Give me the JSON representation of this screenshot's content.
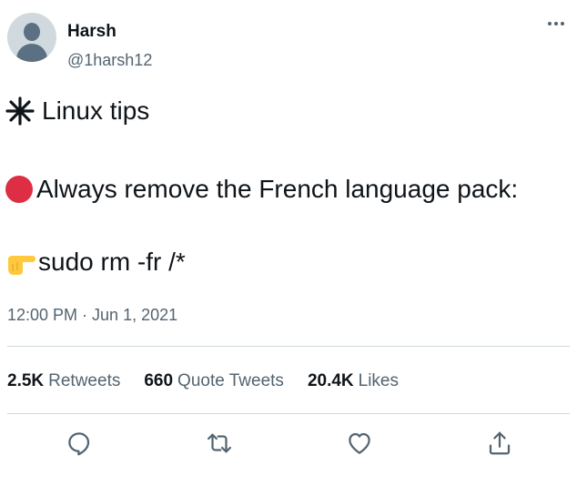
{
  "author": {
    "display_name": "Harsh",
    "handle": "@1harsh12"
  },
  "tweet": {
    "lines": [
      {
        "emoji": "sparkle-icon",
        "text": "Linux tips"
      },
      {
        "emoji": "red-circle-icon",
        "text": "Always remove the French language pack:"
      },
      {
        "emoji": "pointing-right-icon",
        "text": "sudo rm -fr /*"
      }
    ],
    "timestamp": "12:00 PM · Jun 1, 2021"
  },
  "stats": {
    "retweets": {
      "count": "2.5K",
      "label": "Retweets"
    },
    "quote_tweets": {
      "count": "660",
      "label": "Quote Tweets"
    },
    "likes": {
      "count": "20.4K",
      "label": "Likes"
    }
  },
  "actions": [
    "reply-icon",
    "retweet-icon",
    "like-icon",
    "share-icon"
  ],
  "colors": {
    "primary_text": "#0f1419",
    "secondary_text": "#536471",
    "divider": "#cfd9de",
    "red_circle": "#dd2e44",
    "hand_yellow": "#ffc83d"
  }
}
